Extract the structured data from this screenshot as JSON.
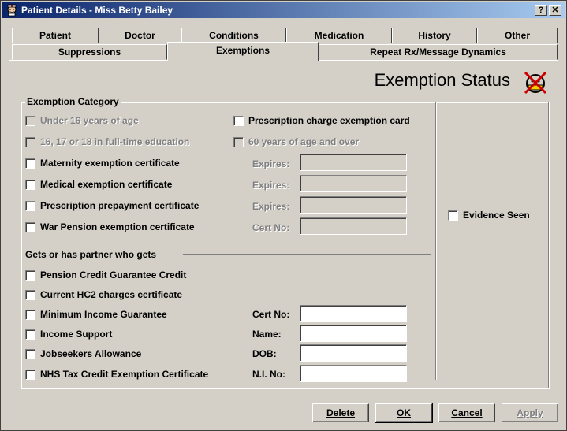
{
  "window": {
    "title": "Patient Details - Miss Betty Bailey",
    "help_label": "?",
    "close_label": "✕"
  },
  "tabs_row1": [
    "Patient",
    "Doctor",
    "Conditions",
    "Medication",
    "History",
    "Other"
  ],
  "tabs_row2": [
    "Suppressions",
    "Exemptions",
    "Repeat Rx/Message Dynamics"
  ],
  "active_tab": "Exemptions",
  "heading": "Exemption Status",
  "category": {
    "title": "Exemption Category",
    "left_items": [
      {
        "label": "Under 16 years of age",
        "checked": false,
        "enabled": false
      },
      {
        "label": "16, 17 or 18 in full-time education",
        "checked": false,
        "enabled": false
      },
      {
        "label": "Maternity exemption certificate",
        "checked": false,
        "enabled": true
      },
      {
        "label": "Medical exemption certificate",
        "checked": false,
        "enabled": true
      },
      {
        "label": "Prescription prepayment certificate",
        "checked": false,
        "enabled": true
      },
      {
        "label": "War Pension exemption certificate",
        "checked": false,
        "enabled": true
      }
    ],
    "right_items": [
      {
        "label": "Prescription charge exemption card",
        "checked": false,
        "enabled": true
      },
      {
        "label": "60 years of age and over",
        "checked": false,
        "enabled": false
      }
    ],
    "detail_fields": [
      {
        "label": "Expires:",
        "value": ""
      },
      {
        "label": "Expires:",
        "value": ""
      },
      {
        "label": "Expires:",
        "value": ""
      },
      {
        "label": "Cert No:",
        "value": ""
      }
    ],
    "partner_heading": "Gets or has partner who gets",
    "partner_items": [
      {
        "label": "Pension Credit Guarantee Credit",
        "checked": false
      },
      {
        "label": "Current HC2 charges certificate",
        "checked": false
      },
      {
        "label": "Minimum Income Guarantee",
        "checked": false
      },
      {
        "label": "Income Support",
        "checked": false
      },
      {
        "label": "Jobseekers Allowance",
        "checked": false
      },
      {
        "label": "NHS Tax Credit Exemption Certificate",
        "checked": false
      }
    ],
    "partner_fields": [
      {
        "label": "Cert No:",
        "value": ""
      },
      {
        "label": "Name:",
        "value": ""
      },
      {
        "label": "DOB:",
        "value": ""
      },
      {
        "label": "N.I. No:",
        "value": ""
      }
    ],
    "evidence_seen": {
      "label": "Evidence Seen",
      "checked": false
    }
  },
  "buttons": {
    "delete": "Delete",
    "ok": "OK",
    "cancel": "Cancel",
    "apply": "Apply"
  },
  "colors": {
    "titlebar_start": "#0a246a",
    "titlebar_end": "#a6caf0",
    "face": "#d4d0c8",
    "status_icon_cross": "#cc0000"
  },
  "icons": {
    "app": "doctor-face-icon",
    "status": "not-exempt-cross-icon"
  }
}
